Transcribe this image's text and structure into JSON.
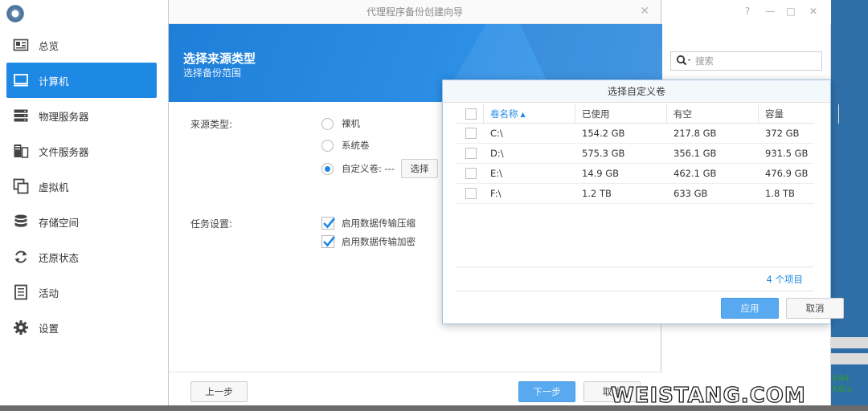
{
  "sidebar": {
    "items": [
      {
        "label": "总览",
        "icon": "overview-icon",
        "active": false
      },
      {
        "label": "计算机",
        "icon": "computer-icon",
        "active": true
      },
      {
        "label": "物理服务器",
        "icon": "server-icon",
        "active": false
      },
      {
        "label": "文件服务器",
        "icon": "file-server-icon",
        "active": false
      },
      {
        "label": "虚拟机",
        "icon": "virtual-machine-icon",
        "active": false
      },
      {
        "label": "存储空间",
        "icon": "storage-icon",
        "active": false
      },
      {
        "label": "还原状态",
        "icon": "restore-icon",
        "active": false
      },
      {
        "label": "活动",
        "icon": "activity-icon",
        "active": false
      },
      {
        "label": "设置",
        "icon": "gear-icon",
        "active": false
      }
    ]
  },
  "background_window": {
    "search_placeholder": "搜索",
    "speed": "694 KB/s"
  },
  "wizard": {
    "title": "代理程序备份创建向导",
    "heading": "选择来源类型",
    "subheading": "选择备份范围",
    "source_type_label": "来源类型:",
    "source_options": [
      {
        "label": "裸机",
        "checked": false
      },
      {
        "label": "系统卷",
        "checked": false
      },
      {
        "label": "自定义卷: ---",
        "checked": true
      }
    ],
    "select_button": "选择",
    "task_settings_label": "任务设置:",
    "task_options": [
      {
        "label": "启用数据传输压缩",
        "checked": true
      },
      {
        "label": "启用数据传输加密",
        "checked": true
      }
    ],
    "prev_button": "上一步",
    "next_button": "下一步",
    "cancel_button": "取消"
  },
  "picker": {
    "title": "选择自定义卷",
    "columns": [
      "卷名称",
      "已使用",
      "有空",
      "容量"
    ],
    "rows": [
      {
        "name": "C:\\",
        "used": "154.2 GB",
        "free": "217.8 GB",
        "capacity": "372 GB"
      },
      {
        "name": "D:\\",
        "used": "575.3 GB",
        "free": "356.1 GB",
        "capacity": "931.5 GB"
      },
      {
        "name": "E:\\",
        "used": "14.9 GB",
        "free": "462.1 GB",
        "capacity": "476.9 GB"
      },
      {
        "name": "F:\\",
        "used": "1.2 TB",
        "free": "633 GB",
        "capacity": "1.8 TB"
      }
    ],
    "count": "4 个项目",
    "apply_button": "应用",
    "cancel_button": "取消"
  },
  "watermark": "WEISTANG.COM",
  "colors": {
    "accent": "#1e88e5",
    "banner": "#2b8de4"
  }
}
